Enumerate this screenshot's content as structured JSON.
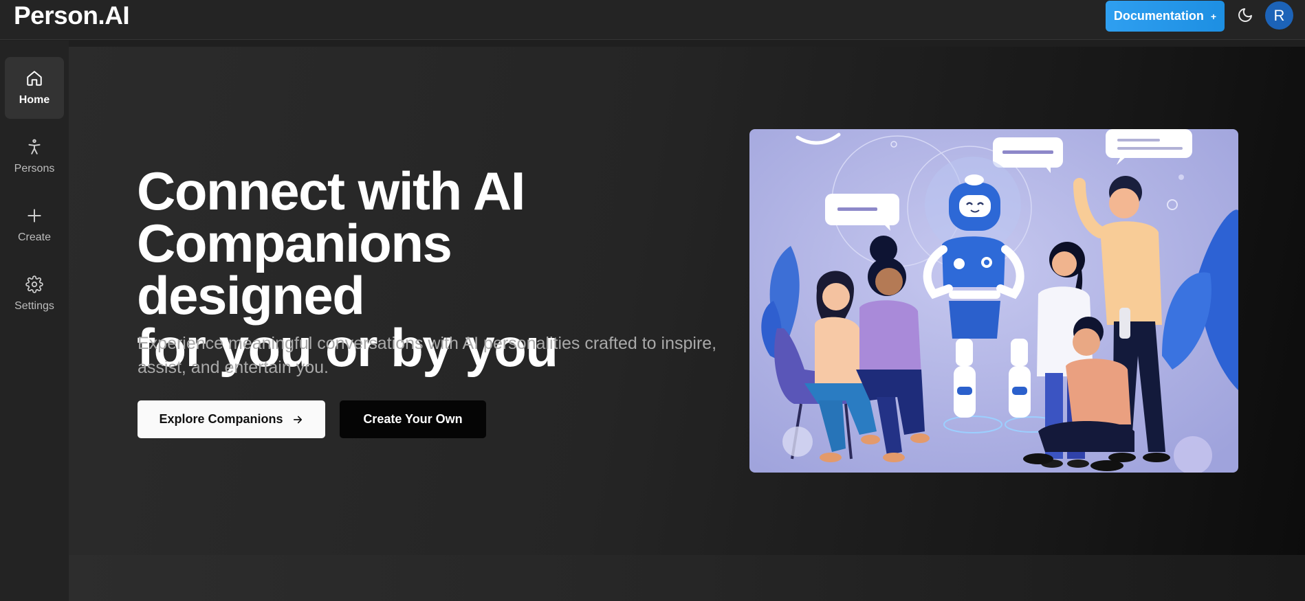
{
  "header": {
    "brand": "Person.AI",
    "documentation_label": "Documentation",
    "documentation_icon": "+",
    "theme_icon": "moon-icon",
    "avatar_initial": "R"
  },
  "sidebar": {
    "items": [
      {
        "label": "Home",
        "icon": "home-icon",
        "active": true
      },
      {
        "label": "Persons",
        "icon": "person-icon",
        "active": false
      },
      {
        "label": "Create",
        "icon": "plus-icon",
        "active": false
      },
      {
        "label": "Settings",
        "icon": "gear-icon",
        "active": false
      }
    ]
  },
  "hero": {
    "headline_line1": "Connect with AI",
    "headline_line2": "Companions designed",
    "headline_line3": "for you or by you",
    "subtext": "Experience meaningful conversations with AI personalities crafted to inspire, assist, and entertain you.",
    "explore_label": "Explore Companions",
    "create_label": "Create Your Own"
  },
  "colors": {
    "accent": "#2f9ff0",
    "avatar": "#1c63b8",
    "background": "#1f1f1f",
    "illustration_bg": "#a9acdf"
  }
}
